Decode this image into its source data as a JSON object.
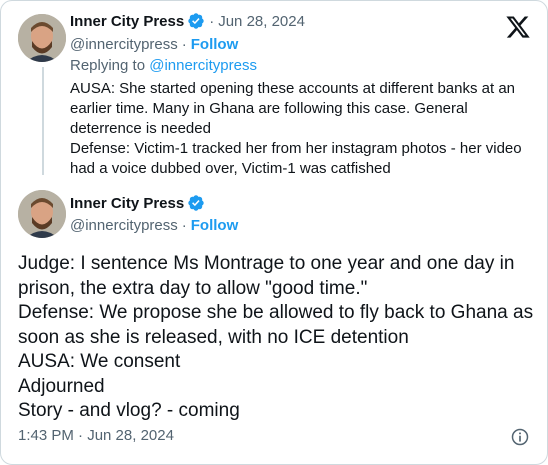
{
  "colors": {
    "accent": "#1d9bf0",
    "text_primary": "#0f1419",
    "text_secondary": "#536471",
    "border": "#cfd9de",
    "verified_badge": "#1d9bf0"
  },
  "icons": [
    "x-logo-icon",
    "verified-badge-icon",
    "info-icon"
  ],
  "reply_tweet": {
    "display_name": "Inner City Press",
    "date": "Jun 28, 2024",
    "separator": "·",
    "handle": "@innercitypress",
    "handle_separator": "·",
    "follow_label": "Follow",
    "replying_prefix": "Replying to ",
    "replying_to": "@innercitypress",
    "text": "AUSA: She started opening these accounts at different banks at an earlier time. Many in Ghana are following this case. General deterrence is needed\nDefense: Victim-1 tracked her from her instagram photos - her video had a voice dubbed over, Victim-1 was catfished"
  },
  "main_tweet": {
    "display_name": "Inner City Press",
    "handle": "@innercitypress",
    "handle_separator": "·",
    "follow_label": "Follow",
    "text": "Judge: I sentence Ms Montrage to one year and one day in prison, the extra day to allow \"good time.\"\nDefense: We propose she be allowed to fly back to Ghana as soon as she is released, with no ICE detention\nAUSA: We consent\nAdjourned\nStory - and vlog? - coming",
    "timestamp": "1:43 PM · Jun 28, 2024"
  }
}
